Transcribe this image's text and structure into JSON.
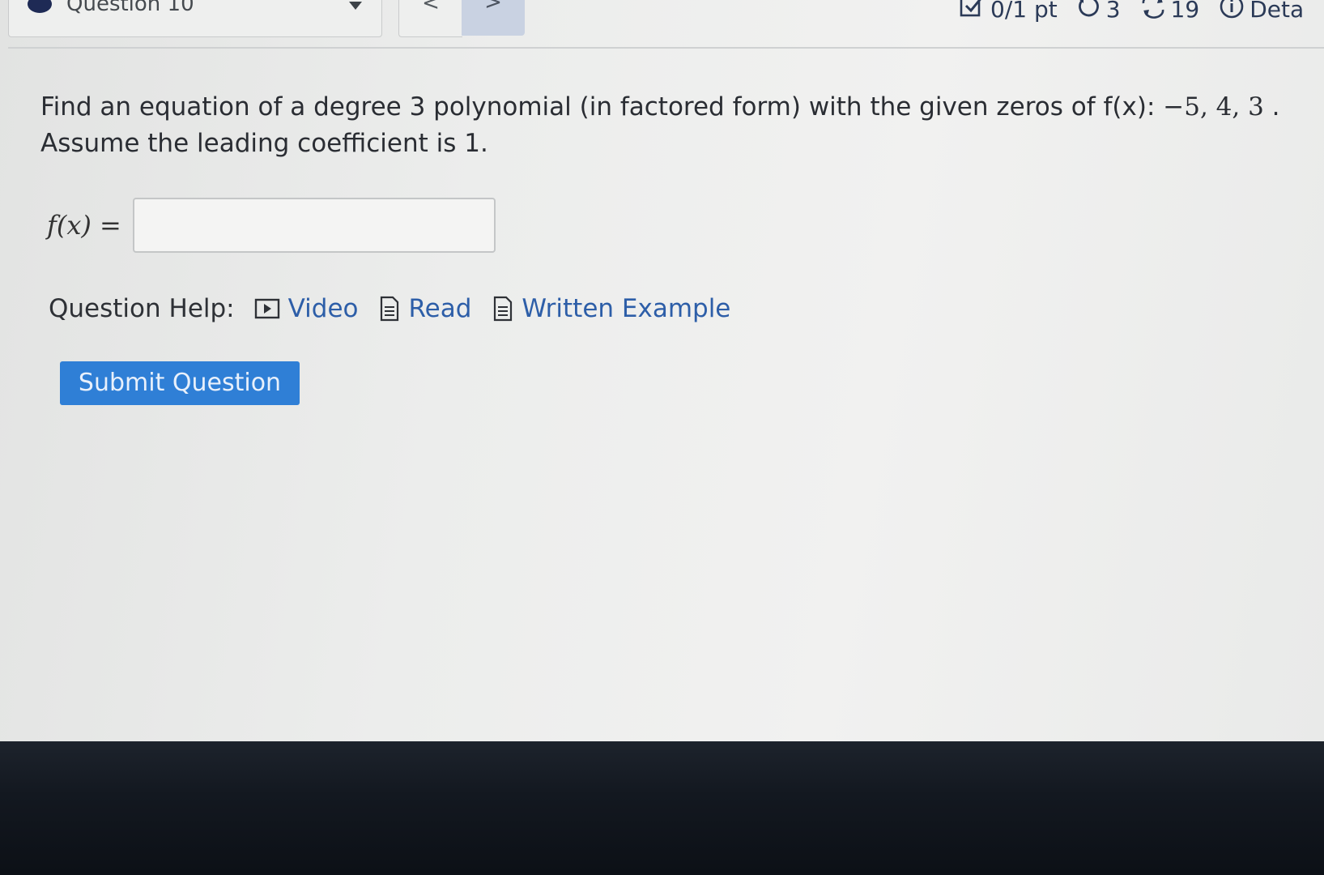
{
  "header": {
    "question_label": "Question 10",
    "prev_label": "<",
    "next_label": ">",
    "score": "0/1 pt",
    "retries": "3",
    "attempts": "19",
    "details_label": "Deta"
  },
  "question": {
    "text": "Find an equation of a degree 3 polynomial (in factored form) with the given zeros of f(x): ",
    "zeros": "−5, 4, 3",
    "text_end": " .",
    "line2": "Assume the leading coefficient is 1."
  },
  "answer": {
    "label": "f(x) =",
    "value": ""
  },
  "help": {
    "label": "Question Help:",
    "video_label": "Video",
    "read_label": "Read",
    "example_label": "Written Example"
  },
  "submit": {
    "label": "Submit Question"
  },
  "colors": {
    "accent": "#2f7fd6",
    "link": "#2d5ea8",
    "status_text": "#2b3a57"
  },
  "icons": {
    "score": "checkbox-icon",
    "retries": "retry-icon",
    "attempts": "refresh-icon",
    "details": "info-icon",
    "video": "video-icon",
    "read": "document-icon",
    "example": "document-icon"
  }
}
